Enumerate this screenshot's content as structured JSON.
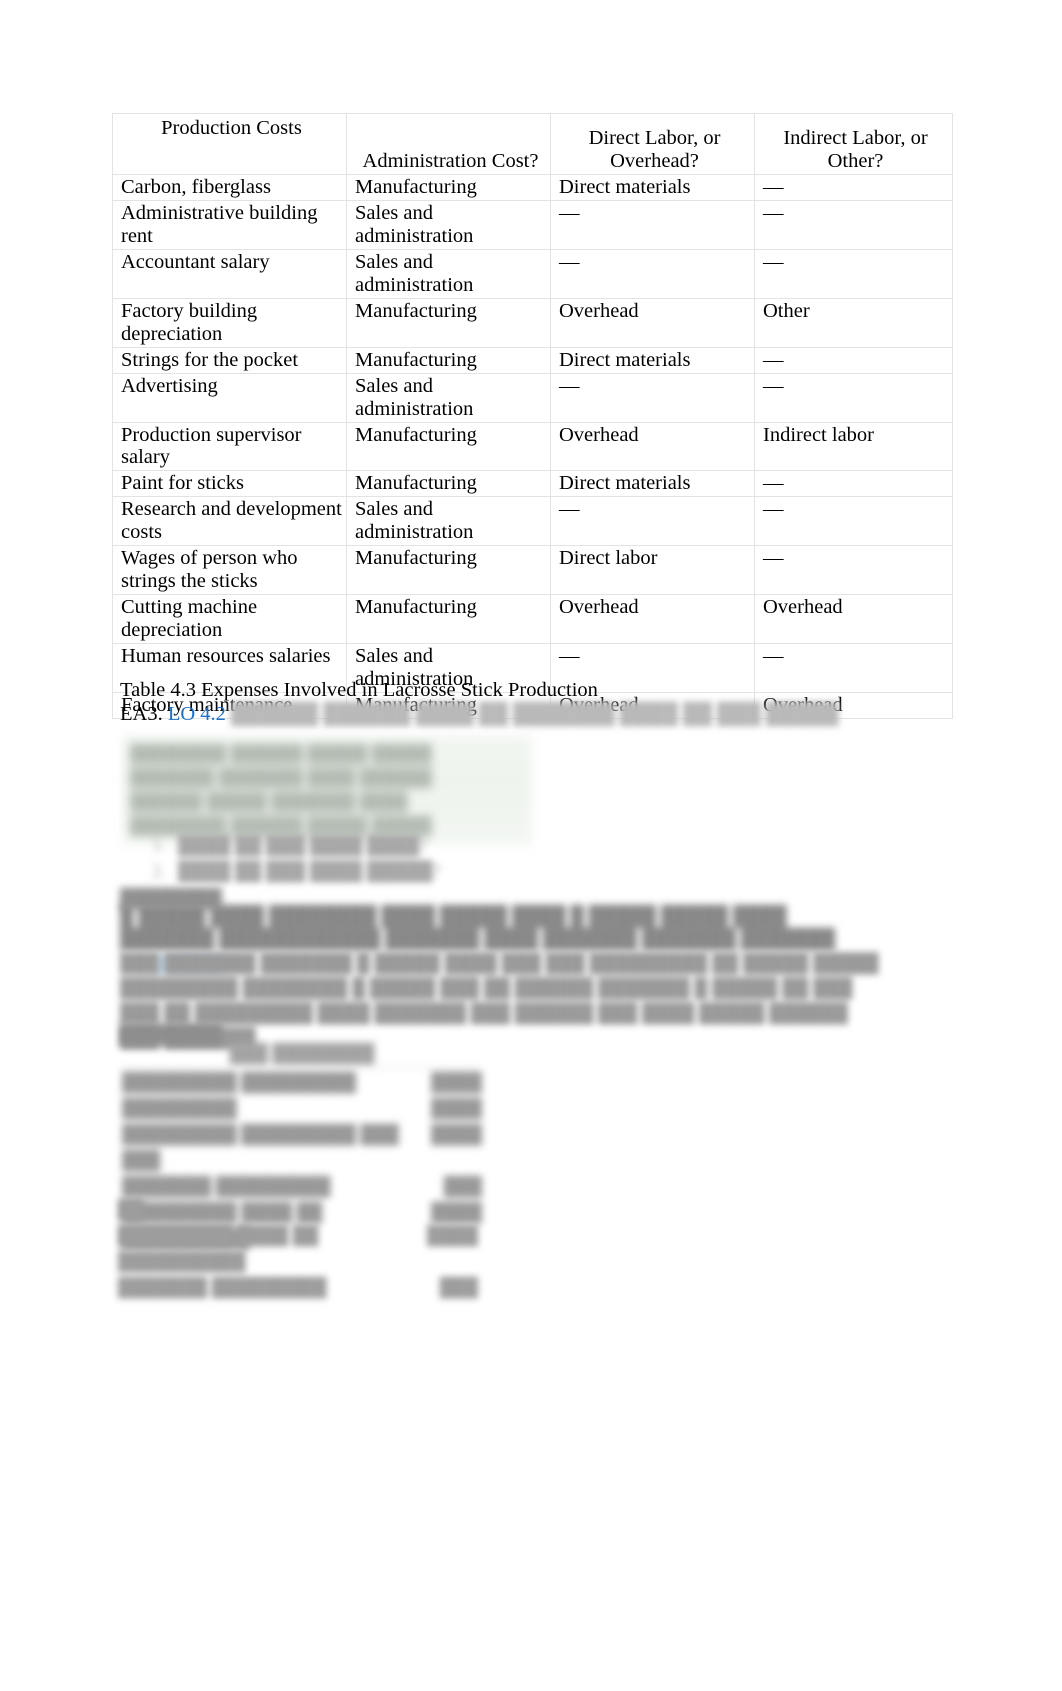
{
  "table": {
    "headers": [
      "Production Costs",
      "Administration Cost?",
      "Direct Labor, or Overhead?",
      "Indirect Labor, or Other?"
    ],
    "rows": [
      {
        "cost": "Carbon, fiberglass",
        "admin": "Manufacturing",
        "labor": "Direct materials",
        "indirect": "—",
        "tall": false
      },
      {
        "cost": "Administrative building rent",
        "admin": "Sales and administration",
        "labor": "—",
        "indirect": "—",
        "tall": true
      },
      {
        "cost": "Accountant salary",
        "admin": "Sales and administration",
        "labor": "—",
        "indirect": "—",
        "tall": true
      },
      {
        "cost": "Factory building depreciation",
        "admin": "Manufacturing",
        "labor": "Overhead",
        "indirect": "Other",
        "tall": true
      },
      {
        "cost": "Strings for the pocket",
        "admin": "Manufacturing",
        "labor": "Direct materials",
        "indirect": "—",
        "tall": false
      },
      {
        "cost": "Advertising",
        "admin": "Sales and administration",
        "labor": "—",
        "indirect": "—",
        "tall": true
      },
      {
        "cost": "Production supervisor salary",
        "admin": "Manufacturing",
        "labor": "Overhead",
        "indirect": "Indirect labor",
        "tall": true
      },
      {
        "cost": "Paint for sticks",
        "admin": "Manufacturing",
        "labor": "Direct materials",
        "indirect": "—",
        "tall": false
      },
      {
        "cost": "Research and development costs",
        "admin": "Sales and administration",
        "labor": "—",
        "indirect": "—",
        "tall": true
      },
      {
        "cost": "Wages of person who strings the sticks",
        "admin": "Manufacturing",
        "labor": "Direct labor",
        "indirect": "—",
        "tall": true
      },
      {
        "cost": "Cutting machine depreciation",
        "admin": "Manufacturing",
        "labor": "Overhead",
        "indirect": "Overhead",
        "tall": true
      },
      {
        "cost": "Human resources salaries",
        "admin": "Sales and administration",
        "labor": "—",
        "indirect": "—",
        "tall": true
      },
      {
        "cost": "Factory maintenance",
        "admin": "Manufacturing",
        "labor": "Overhead",
        "indirect": "Overhead",
        "tall": false
      }
    ]
  },
  "caption": "Table 4.3 Expenses Involved in Lacrosse Stick Production",
  "exercise": {
    "id": "EA3.",
    "lo": "LO 4.2",
    "prompt_blurred": "██████ ██████ ████ ██ ███████ ████ ██ ███ █████"
  },
  "redacted": {
    "green_table_rows": [
      "████████  ██████  █████  █████",
      "███████  ███████  ████  ██████",
      "██████  █████  ███████  ████",
      "████████  ██████  █████  █████"
    ],
    "list_items": [
      "████ ██ ███ ████ ████?",
      "████ ██ ███ ████ █████?"
    ],
    "solution_label": "████████",
    "paragraph_bold": "█ █████ ████ ████████ ████ █████ ████ █ █████ █████ ████ ███████ ████████████ ███████ ████ ███████ ███████ ███████",
    "paragraph_body": "███ ███████ ███████ █ █████ ████ ███ ███ █████████ ██ █████ █████  █████████ ████████ █ █████ ███ ██ ██████ ███████ █ █████  ██ ███ ███ ██ █████████ ████ ███████ ███ ██████ ███ ████ █████ ██████ ███ ███████",
    "solution_label2": "████████",
    "bottom_table": {
      "header": "███ ████████",
      "rows": [
        {
          "label": "█████████ █████████",
          "value": "████"
        },
        {
          "label": "█████████",
          "value": "████"
        },
        {
          "label": "█████████ █████████ ███ ███",
          "value": "████"
        },
        {
          "label": "███████ █████████",
          "value": "███"
        },
        {
          "label": "█████████ ████ ██ ██████████",
          "value": "████"
        }
      ]
    },
    "bottom_note": {
      "marker": "██",
      "rows": [
        {
          "label": "█████████ ████ ██ ██████████",
          "value": "████"
        },
        {
          "label": "███████ █████████",
          "value": "███"
        }
      ]
    }
  }
}
